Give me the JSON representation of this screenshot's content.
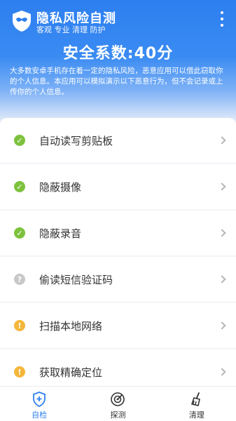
{
  "header": {
    "app_name": "隐私风险自测",
    "slogan": "客观 专业 清理 防护",
    "score_text": "安全系数:40分",
    "description": "大多数安卓手机存在着一定的隐私风险，恶意应用可以借此窃取你的个人信息。本应用可以模拟演示以下恶意行为，但不会记录或上传你的个人信息。"
  },
  "items": [
    {
      "label": "自动读写剪贴板",
      "status": "ok"
    },
    {
      "label": "隐蔽摄像",
      "status": "ok"
    },
    {
      "label": "隐蔽录音",
      "status": "ok"
    },
    {
      "label": "偷读短信验证码",
      "status": "unknown"
    },
    {
      "label": "扫描本地网络",
      "status": "warn"
    },
    {
      "label": "获取精确定位",
      "status": "warn"
    }
  ],
  "tabs": [
    {
      "label": "自检",
      "icon": "shield-plus-icon",
      "active": true
    },
    {
      "label": "探测",
      "icon": "radar-icon",
      "active": false
    },
    {
      "label": "清理",
      "icon": "broom-icon",
      "active": false
    }
  ],
  "colors": {
    "accent": "#2d7ff0",
    "ok": "#7dc23e",
    "warn": "#f4b73b",
    "unknown": "#c8c8c8"
  }
}
